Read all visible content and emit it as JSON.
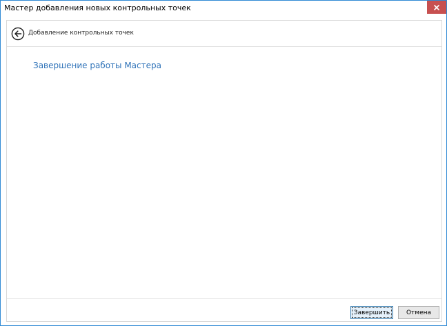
{
  "window": {
    "title": "Мастер добавления новых контрольных точек",
    "close_icon": "close-icon",
    "accent_color": "#2f8ad4",
    "close_color": "#c75050"
  },
  "header": {
    "back_icon": "back-arrow-icon",
    "title": "Добавление контрольных точек"
  },
  "main": {
    "heading": "Завершение работы Мастера",
    "heading_color": "#2e72b8"
  },
  "footer": {
    "finish_label": "Завершить",
    "cancel_label": "Отмена"
  }
}
